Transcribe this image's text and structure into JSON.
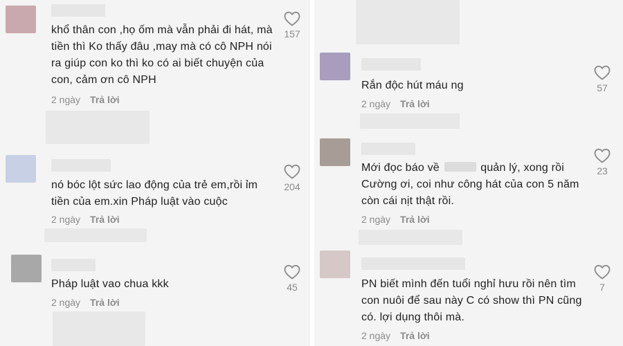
{
  "left": {
    "comments": [
      {
        "text": "khổ thân con ,họ ốm mà vẫn phải đi hát, mà tiền thì Ko thấy đâu ,may mà có cô NPH nói ra giúp con ko thì ko có ai biết chuyện của con, cảm ơn cô NPH",
        "time": "2 ngày",
        "reply": "Trả lời",
        "likes": "157",
        "avatar_color": "#c9a9ae"
      },
      {
        "text": "nó bóc lột sức lao động của trẻ em,rồi ỉm tiền của em.xin Pháp luật vào cuộc",
        "time": "2 ngày",
        "reply": "Trả lời",
        "likes": "204",
        "avatar_color": "#c8d0e6"
      },
      {
        "text": "Pháp luật vao chua kkk",
        "time": "2 ngày",
        "reply": "Trả lời",
        "likes": "45",
        "avatar_color": "#a8a8a8"
      }
    ]
  },
  "right": {
    "comments": [
      {
        "text": "Rắn độc hút máu ng",
        "time": "2 ngày",
        "reply": "Trả lời",
        "likes": "57",
        "avatar_color": "#a99cbd"
      },
      {
        "text_before": "Mới đọc báo về",
        "text_after": "quản lý, xong rồi Cường ơi, coi như công hát của con 5 năm còn cái nịt thật rồi.",
        "time": "2 ngày",
        "reply": "Trả lời",
        "likes": "23",
        "avatar_color": "#a89c96"
      },
      {
        "text": "PN biết mình đến tuổi nghỉ hưu rồi nên tìm con nuôi để sau này C có show thì PN cũng có. lợi dụng thôi mà.",
        "time": "2 ngày",
        "reply": "Trả lời",
        "likes": "7",
        "avatar_color": "#d6c8c6"
      }
    ]
  },
  "colors": {
    "panel_bg": "#f4f4f4",
    "text": "#1f1f1f",
    "meta": "#8a8a8a",
    "heart_stroke": "#8a8a8a"
  },
  "icons": {
    "like": "heart-outline-icon"
  }
}
